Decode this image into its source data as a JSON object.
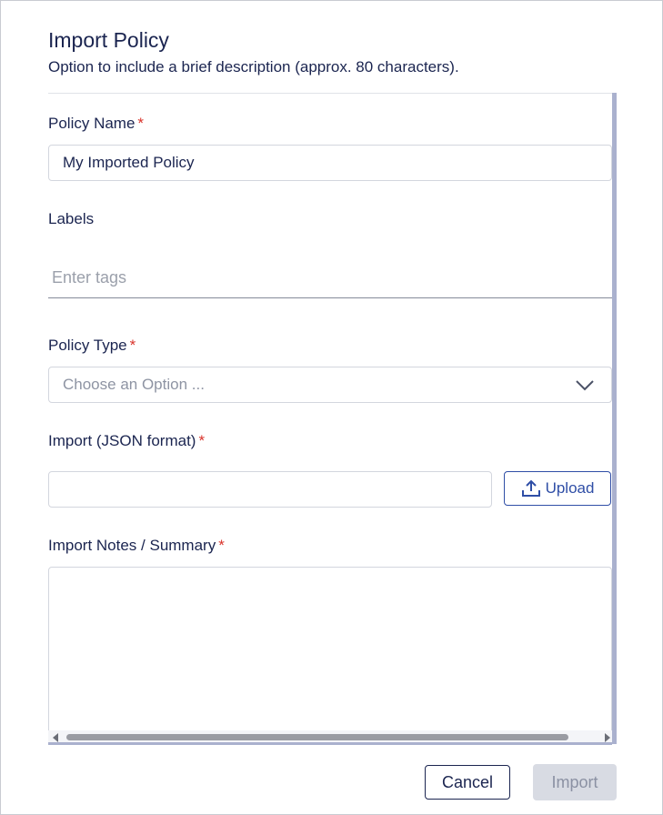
{
  "dialog": {
    "title": "Import Policy",
    "subtitle": "Option to include a brief description (approx. 80 characters)."
  },
  "form": {
    "policy_name": {
      "label": "Policy Name",
      "required_mark": "*",
      "value": "My Imported Policy"
    },
    "labels": {
      "label": "Labels",
      "placeholder": "Enter tags"
    },
    "policy_type": {
      "label": "Policy Type",
      "required_mark": "*",
      "placeholder": "Choose an Option ...",
      "icon": "chevron-down-icon"
    },
    "import_json": {
      "label": "Import (JSON format)",
      "required_mark": "*",
      "value": "",
      "upload_label": "Upload",
      "upload_icon": "upload-icon"
    },
    "import_notes": {
      "label": "Import Notes / Summary",
      "required_mark": "*",
      "value": ""
    }
  },
  "footer": {
    "cancel_label": "Cancel",
    "import_label": "Import"
  },
  "colors": {
    "text_primary": "#1b2550",
    "required": "#d9332b",
    "accent": "#2f4ea6",
    "disabled_bg": "#d8dbe3",
    "scrollbar": "#aab1ce"
  }
}
